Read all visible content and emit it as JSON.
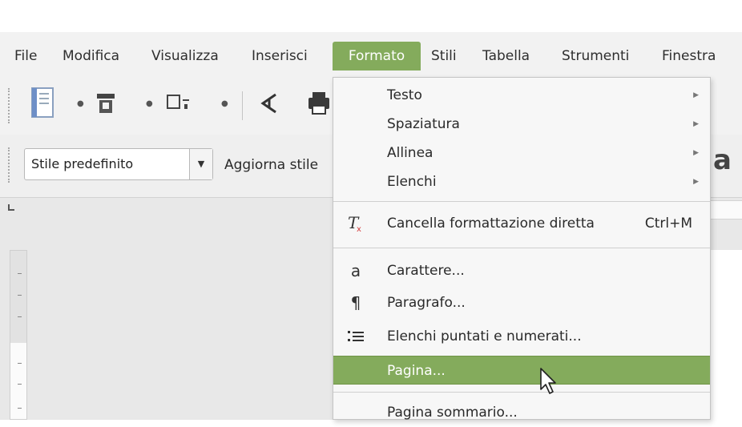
{
  "menubar": {
    "items": [
      {
        "label": "File"
      },
      {
        "label": "Modifica"
      },
      {
        "label": "Visualizza"
      },
      {
        "label": "Inserisci"
      },
      {
        "label": "Formato"
      },
      {
        "label": "Stili"
      },
      {
        "label": "Tabella"
      },
      {
        "label": "Strumenti"
      },
      {
        "label": "Finestra"
      }
    ],
    "active": "Formato"
  },
  "toolbar": {
    "style_value": "Stile predefinito",
    "update_label": "Aggiorna stile"
  },
  "sidebar_partial_glyph": "a",
  "format_menu": {
    "items": [
      {
        "label": "Testo",
        "submenu": true
      },
      {
        "label": "Spaziatura",
        "submenu": true
      },
      {
        "label": "Allinea",
        "submenu": true
      },
      {
        "label": "Elenchi",
        "submenu": true
      },
      {
        "label": "Cancella formattazione diretta",
        "shortcut": "Ctrl+M",
        "icon": "clear-formatting-icon"
      },
      {
        "label": "Carattere...",
        "icon": "character-icon",
        "icon_glyph": "a"
      },
      {
        "label": "Paragrafo...",
        "icon": "paragraph-icon",
        "icon_glyph": "¶"
      },
      {
        "label": "Elenchi puntati e numerati...",
        "icon": "bullets-numbering-icon"
      },
      {
        "label": "Pagina...",
        "highlighted": true
      },
      {
        "label": "Pagina sommario..."
      }
    ]
  },
  "colors": {
    "accent": "#84ab5c",
    "menu_bg": "#f7f7f7",
    "toolbar_bg": "#f2f2f2"
  }
}
